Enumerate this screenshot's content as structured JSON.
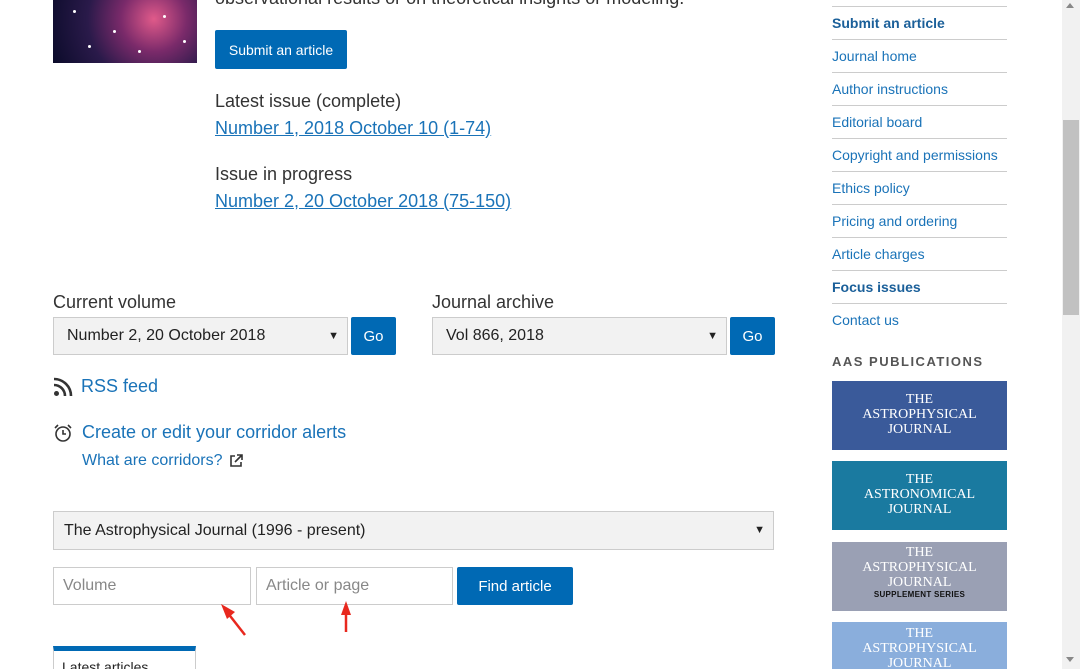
{
  "intro": {
    "cut_text": "observational results or on theoretical insights or modeling.",
    "submit_label": "Submit an article"
  },
  "issues": {
    "latest_label": "Latest issue (complete)",
    "latest_link": "Number 1, 2018 October 10 (1-74)",
    "progress_label": "Issue in progress",
    "progress_link": "Number 2, 20 October 2018 (75-150)"
  },
  "current_volume": {
    "label": "Current volume",
    "selected": "Number 2, 20 October 2018",
    "go_label": "Go"
  },
  "journal_archive": {
    "label": "Journal archive",
    "selected": "Vol 866, 2018",
    "go_label": "Go"
  },
  "rss": {
    "label": "RSS feed",
    "icon": "rss-icon"
  },
  "alerts": {
    "label": "Create or edit your corridor alerts",
    "icon": "alarm-clock-icon",
    "corridors_link": "What are corridors?",
    "external_icon": "external-link-icon"
  },
  "article_finder": {
    "journal_selected": "The Astrophysical Journal (1996 - present)",
    "volume_placeholder": "Volume",
    "article_placeholder": "Article or page",
    "find_label": "Find article",
    "annotation_color": "#e8281e"
  },
  "tabs": {
    "first_label": "Latest articles"
  },
  "sidebar": {
    "items": [
      {
        "label": "Submit an article",
        "bold": true
      },
      {
        "label": "Journal home",
        "bold": false
      },
      {
        "label": "Author instructions",
        "bold": false
      },
      {
        "label": "Editorial board",
        "bold": false
      },
      {
        "label": "Copyright and permissions",
        "bold": false
      },
      {
        "label": "Ethics policy",
        "bold": false
      },
      {
        "label": "Pricing and ordering",
        "bold": false
      },
      {
        "label": "Article charges",
        "bold": false
      },
      {
        "label": "Focus issues",
        "bold": true
      },
      {
        "label": "Contact us",
        "bold": false
      }
    ],
    "aas_title": "AAS PUBLICATIONS",
    "publications": [
      {
        "lines": [
          "THE",
          "ASTROPHYSICAL",
          "JOURNAL"
        ],
        "sub": "",
        "color": "#3a5a9a"
      },
      {
        "lines": [
          "THE",
          "ASTRONOMICAL",
          "JOURNAL"
        ],
        "sub": "",
        "color": "#1a7aa0"
      },
      {
        "lines": [
          "THE",
          "ASTROPHYSICAL",
          "JOURNAL"
        ],
        "sub": "SUPPLEMENT SERIES",
        "color": "#9aa0b4"
      },
      {
        "lines": [
          "THE",
          "ASTROPHYSICAL",
          "JOURNAL"
        ],
        "sub": "",
        "color": "#8aaedc"
      }
    ]
  },
  "colors": {
    "primary_button": "#0069b4",
    "link": "#1a73b8"
  }
}
